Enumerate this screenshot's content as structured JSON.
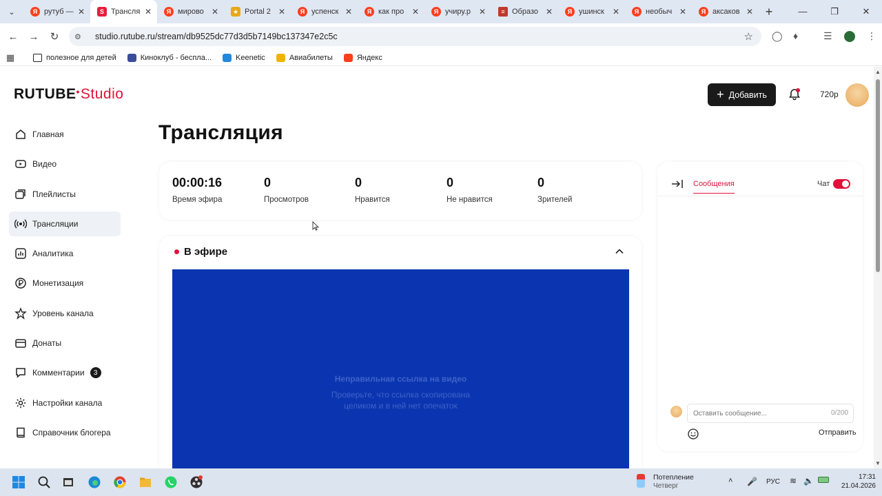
{
  "browser": {
    "tabs": [
      {
        "title": "рутуб —",
        "icon": "yandex-icon",
        "active": false
      },
      {
        "title": "Трансля",
        "icon": "rutube-studio-icon",
        "active": true
      },
      {
        "title": "мирово",
        "icon": "yandex-icon",
        "active": false
      },
      {
        "title": "Portal 2",
        "icon": "trophy-icon",
        "active": false
      },
      {
        "title": "успенск",
        "icon": "yandex-icon",
        "active": false
      },
      {
        "title": "как про",
        "icon": "yandex-icon",
        "active": false
      },
      {
        "title": "учиру.р",
        "icon": "yandex-icon",
        "active": false
      },
      {
        "title": "Образо",
        "icon": "document-icon",
        "active": false
      },
      {
        "title": "ушинск",
        "icon": "yandex-icon",
        "active": false
      },
      {
        "title": "необыч",
        "icon": "yandex-icon",
        "active": false
      },
      {
        "title": "аксаков",
        "icon": "yandex-icon",
        "active": false
      }
    ],
    "url": "studio.rutube.ru/stream/db9525dc77d3d5b7149bc137347e2c5c",
    "bookmarks": [
      {
        "label": "полезное для детей",
        "icon": "folder-icon"
      },
      {
        "label": "Киноклуб - бесплa...",
        "icon": "film-icon"
      },
      {
        "label": "Keenetic",
        "icon": "keenetic-icon"
      },
      {
        "label": "Авиабилеты",
        "icon": "plane-icon"
      },
      {
        "label": "Яндекс",
        "icon": "yandex-icon"
      }
    ]
  },
  "app": {
    "logo_main": "RUTUBE",
    "logo_sub": "Studio",
    "add_label": "Добавить",
    "quality": "720p",
    "nav": [
      {
        "label": "Главная",
        "icon": "home-icon",
        "active": false
      },
      {
        "label": "Видео",
        "icon": "video-icon",
        "active": false
      },
      {
        "label": "Плейлисты",
        "icon": "playlist-icon",
        "active": false
      },
      {
        "label": "Трансляции",
        "icon": "broadcast-icon",
        "active": true
      },
      {
        "label": "Аналитика",
        "icon": "analytics-icon",
        "active": false
      },
      {
        "label": "Монетизация",
        "icon": "ruble-icon",
        "active": false
      },
      {
        "label": "Уровень канала",
        "icon": "level-icon",
        "active": false
      },
      {
        "label": "Донаты",
        "icon": "donate-icon",
        "active": false
      },
      {
        "label": "Комментарии",
        "icon": "comment-icon",
        "active": false,
        "badge": "3"
      },
      {
        "label": "Настройки канала",
        "icon": "gear-icon",
        "active": false
      },
      {
        "label": "Справочник блогера",
        "icon": "book-icon",
        "active": false
      }
    ],
    "page_title": "Трансляция",
    "stats": [
      {
        "value": "00:00:16",
        "label": "Время эфира"
      },
      {
        "value": "0",
        "label": "Просмотров"
      },
      {
        "value": "0",
        "label": "Нравится"
      },
      {
        "value": "0",
        "label": "Не нравится"
      },
      {
        "value": "0",
        "label": "Зрителей"
      }
    ],
    "live": {
      "title": "В эфире",
      "error_title": "Неправильная ссылка на видео",
      "error_text": "Проверьте, что ссылка скопирована целиком и в ней нет опечаток"
    },
    "chat": {
      "tab_messages": "Сообщения",
      "chat_label": "Чат",
      "chat_enabled": true,
      "input_placeholder": "Оставить сообщение...",
      "counter": "0/200",
      "send_label": "Отправить"
    }
  },
  "taskbar": {
    "weather_title": "Потепление",
    "weather_sub": "Четверг",
    "lang": "РУС",
    "time": "17:31",
    "date": "21.04.2026"
  },
  "colors": {
    "accent": "#e0123c",
    "player_bg": "#0b34b0",
    "dark_button": "#1a1a1a"
  }
}
